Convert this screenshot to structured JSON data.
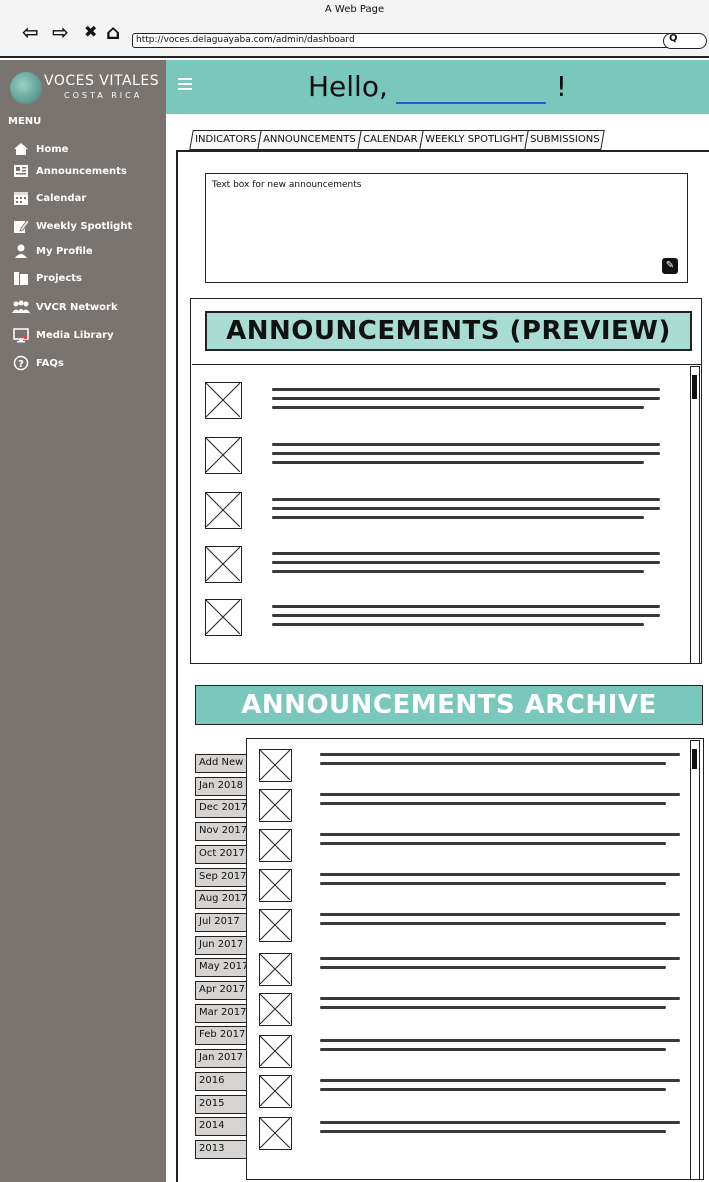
{
  "browser": {
    "page_title": "A Web Page",
    "url": "http://voces.delaguayaba.com/admin/dashboard",
    "back": "⇦",
    "forward": "⇨",
    "close": "✖",
    "home": "⌂",
    "search_glyph": "Q"
  },
  "logo": {
    "line1": "VOCES VITALES",
    "line2": "COSTA RICA"
  },
  "sidebar": {
    "menu_title": "MENU",
    "items": [
      {
        "label": "Home",
        "icon": "home-icon"
      },
      {
        "label": "Announcements",
        "icon": "newspaper-icon"
      },
      {
        "label": "Calendar",
        "icon": "calendar-icon"
      },
      {
        "label": "Weekly Spotlight",
        "icon": "edit-icon"
      },
      {
        "label": "My Profile",
        "icon": "user-icon"
      },
      {
        "label": "Projects",
        "icon": "folder-icon"
      },
      {
        "label": "VVCR Network",
        "icon": "network-icon"
      },
      {
        "label": "Media Library",
        "icon": "monitor-icon"
      },
      {
        "label": "FAQs",
        "icon": "help-icon"
      }
    ]
  },
  "header": {
    "greeting": "Hello,",
    "exclaim": "!"
  },
  "tabs": [
    "INDICATORS",
    "ANNOUNCEMENTS",
    "CALENDAR",
    "WEEKLY SPOTLIGHT",
    "SUBMISSIONS"
  ],
  "composer": {
    "placeholder": "Text box for new announcements"
  },
  "preview": {
    "title": "ANNOUNCEMENTS (PREVIEW)"
  },
  "archive": {
    "title": "ANNOUNCEMENTS ARCHIVE",
    "tabs": [
      "Add New",
      "Jan 2018",
      "Dec 2017",
      "Nov 2017",
      "Oct 2017",
      "Sep 2017",
      "Aug 2017",
      "Jul 2017",
      "Jun 2017",
      "May 2017",
      "Apr 2017",
      "Mar 2017",
      "Feb 2017",
      "Jan 2017",
      "2016",
      "2015",
      "2014",
      "2013"
    ]
  },
  "colors": {
    "teal": "#7ac8bb",
    "teal_light": "#a9dcd3",
    "sidebar": "#7a7470"
  }
}
